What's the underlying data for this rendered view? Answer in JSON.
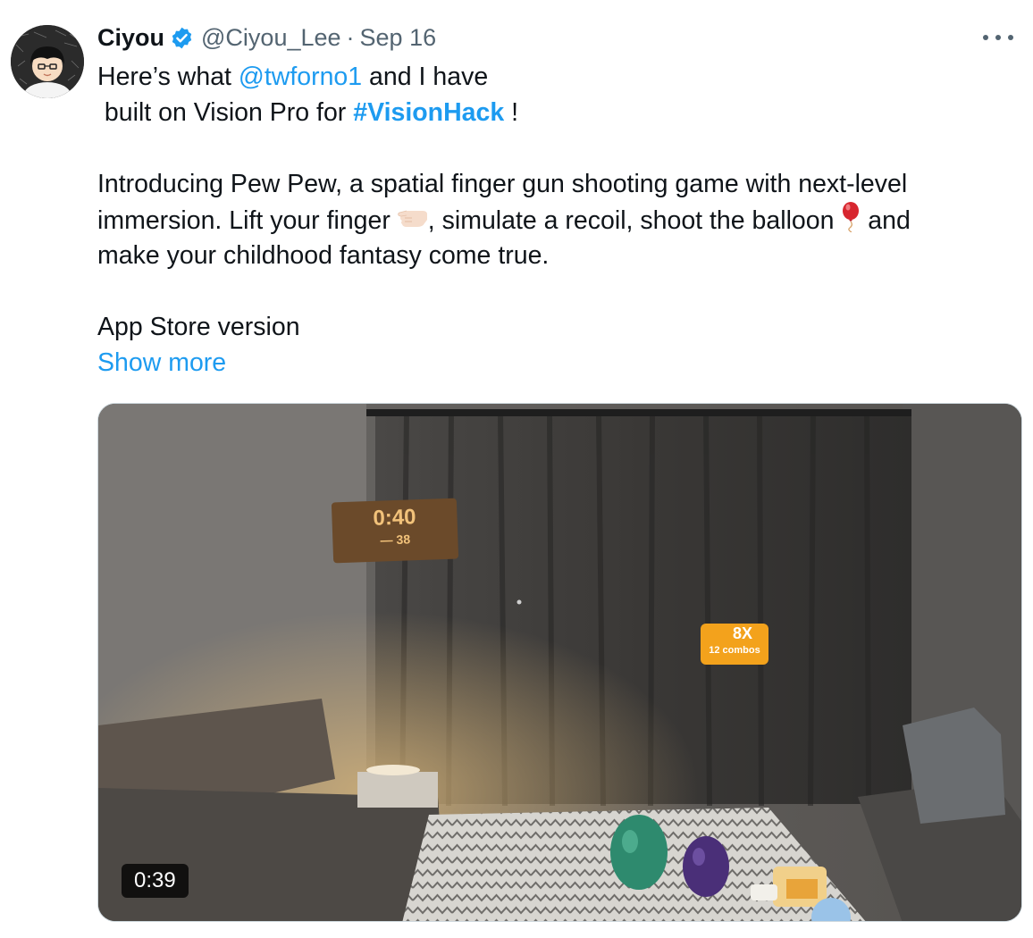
{
  "author": {
    "display_name": "Ciyou",
    "handle": "@Ciyou_Lee",
    "separator": "·",
    "date": "Sep 16"
  },
  "tweet": {
    "line1_pre": "Here’s what ",
    "mention": "@twforno1",
    "line1_post": " and I have",
    "line2_pre": " built on Vision Pro for ",
    "hashtag": "#VisionHack",
    "line2_post": " !",
    "para2_line1": "Introducing Pew Pew, a spatial finger gun shooting game with next-level",
    "para2_line2_a": "immersion. Lift your finger ",
    "para2_line2_b": ", simulate a recoil, shoot the balloon ",
    "para2_line2_c": " and",
    "para2_line3": "make your childhood fantasy come true.",
    "para3_line1": "App Store version",
    "show_more": "Show more"
  },
  "media": {
    "duration": "0:39",
    "hud_timer": "0:40",
    "hud_timer_sub": "— 38",
    "hud_combo": "8X",
    "hud_combo_sub": "12 combos"
  },
  "icons": {
    "verified": "verified-badge-icon",
    "more": "more-options-icon",
    "finger": "backhand-index-pointing-left-emoji",
    "balloon": "balloon-emoji"
  },
  "colors": {
    "link": "#1d9bf0",
    "text": "#0f1419",
    "secondary": "#536471"
  }
}
